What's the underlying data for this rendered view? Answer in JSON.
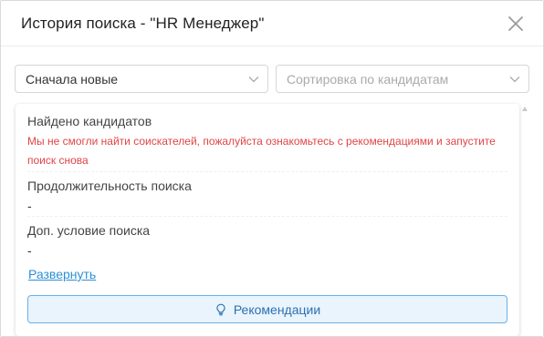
{
  "dialog": {
    "title": "История поиска - \"HR Менеджер\"",
    "close_icon": "close-icon"
  },
  "filters": {
    "sort_order": {
      "value": "Сначала новые",
      "icon": "chevron-down-icon"
    },
    "sort_by_candidates": {
      "placeholder": "Сортировка по кандидатам",
      "icon": "chevron-down-icon"
    }
  },
  "result": {
    "found_label": "Найдено кандидатов",
    "error_message": "Мы не смогли найти соискателей, пожалуйста ознакомьтесь с рекомендациями и запустите поиск снова",
    "duration_label": "Продолжительность поиска",
    "duration_value": "-",
    "extra_condition_label": "Доп. условие поиска",
    "extra_condition_value": "-",
    "expand_link": "Развернуть",
    "recommendations_button": {
      "label": "Рекомендации",
      "icon": "lightbulb-icon"
    }
  },
  "colors": {
    "error": "#e04545",
    "link": "#2b8fd6",
    "button_bg": "#eaf4fd",
    "button_border": "#6ab0e6"
  }
}
